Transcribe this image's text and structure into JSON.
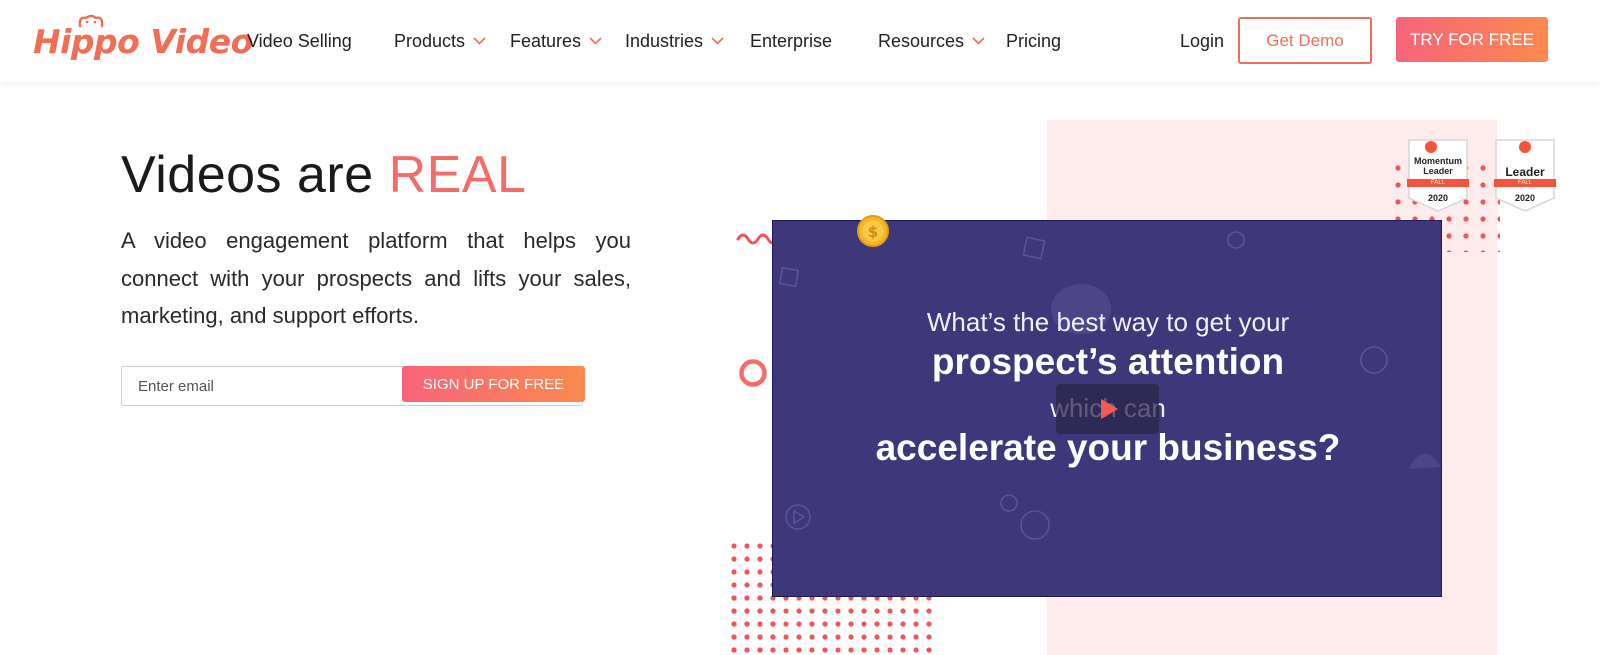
{
  "brand": {
    "logo_text": "Hippo Video",
    "accent_color": "#f26d55",
    "gradient_start": "#f7647a",
    "gradient_end": "#fb8a4f",
    "video_bg_color": "#3e377a"
  },
  "nav": {
    "items": [
      {
        "label": "Video Selling",
        "has_dropdown": false
      },
      {
        "label": "Products",
        "has_dropdown": true
      },
      {
        "label": "Features",
        "has_dropdown": true
      },
      {
        "label": "Industries",
        "has_dropdown": true
      },
      {
        "label": "Enterprise",
        "has_dropdown": false
      },
      {
        "label": "Resources",
        "has_dropdown": true
      },
      {
        "label": "Pricing",
        "has_dropdown": false
      }
    ],
    "login_label": "Login",
    "demo_label": "Get Demo",
    "try_label": "TRY FOR FREE"
  },
  "hero": {
    "title_prefix": "Videos are",
    "title_accent": "REAL",
    "subtitle": "A video engagement platform that helps you connect with your prospects and lifts your sales, marketing, and support efforts.",
    "email_placeholder": "Enter email",
    "signup_label": "SIGN UP FOR FREE"
  },
  "video": {
    "line1": "What’s the best way to get your",
    "line2": "prospect’s attention",
    "line3": "which can",
    "line4": "accelerate your business?"
  },
  "badges": [
    {
      "name": "Momentum Leader",
      "season": "FALL",
      "year": "2020",
      "icon": "g2-logo-icon"
    },
    {
      "name": "Leader",
      "season": "FALL",
      "year": "2020",
      "icon": "g2-logo-icon"
    }
  ]
}
